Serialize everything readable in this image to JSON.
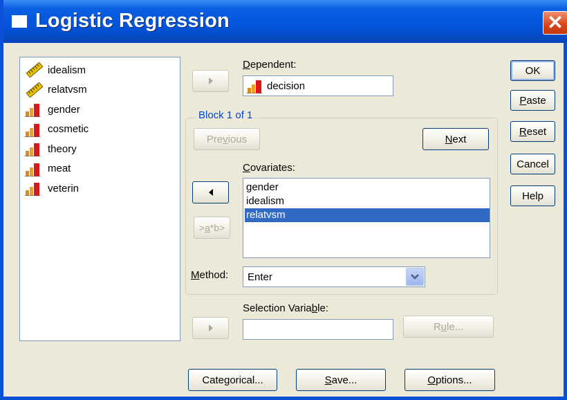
{
  "window": {
    "title": "Logistic Regression",
    "close_label": "✕"
  },
  "variables": [
    {
      "name": "idealism",
      "icon": "scale-ruler-icon"
    },
    {
      "name": "relatvsm",
      "icon": "scale-ruler-icon"
    },
    {
      "name": "gender",
      "icon": "nominal-bar-icon"
    },
    {
      "name": "cosmetic",
      "icon": "nominal-bar-icon"
    },
    {
      "name": "theory",
      "icon": "nominal-bar-icon"
    },
    {
      "name": "meat",
      "icon": "nominal-bar-icon"
    },
    {
      "name": "veterin",
      "icon": "nominal-bar-icon"
    }
  ],
  "dependent": {
    "label_pre": "",
    "label_ul": "D",
    "label_post": "ependent:",
    "value": "decision",
    "icon": "nominal-bar-icon"
  },
  "block": {
    "legend": "Block 1 of 1",
    "previous_pre": "Pre",
    "previous_ul": "v",
    "previous_post": "ious",
    "next_pre": "",
    "next_ul": "N",
    "next_post": "ext"
  },
  "covariates": {
    "label_pre": "",
    "label_ul": "C",
    "label_post": "ovariates:",
    "items": [
      "gender",
      "idealism",
      "relatvsm"
    ],
    "selected_index": 2,
    "interaction_pre": ">",
    "interaction_ul": "a",
    "interaction_post": "*b>"
  },
  "method": {
    "label_pre": "",
    "label_ul": "M",
    "label_post": "ethod:",
    "value": "Enter"
  },
  "selection": {
    "label_pre": "Selection Varia",
    "label_ul": "b",
    "label_post": "le:",
    "value": "",
    "rule_pre": "R",
    "rule_ul": "u",
    "rule_post": "le..."
  },
  "side_buttons": {
    "ok": "OK",
    "paste_pre": "",
    "paste_ul": "P",
    "paste_post": "aste",
    "reset_pre": "",
    "reset_ul": "R",
    "reset_post": "eset",
    "cancel": "Cancel",
    "help": "Help"
  },
  "bottom_buttons": {
    "categorical": "Categorical...",
    "save_pre": "",
    "save_ul": "S",
    "save_post": "ave...",
    "options_pre": "",
    "options_ul": "O",
    "options_post": "ptions..."
  },
  "colors": {
    "accent": "#316ac5",
    "titlebar": "#0355dc",
    "face": "#ece9d8",
    "close": "#d8441a"
  }
}
